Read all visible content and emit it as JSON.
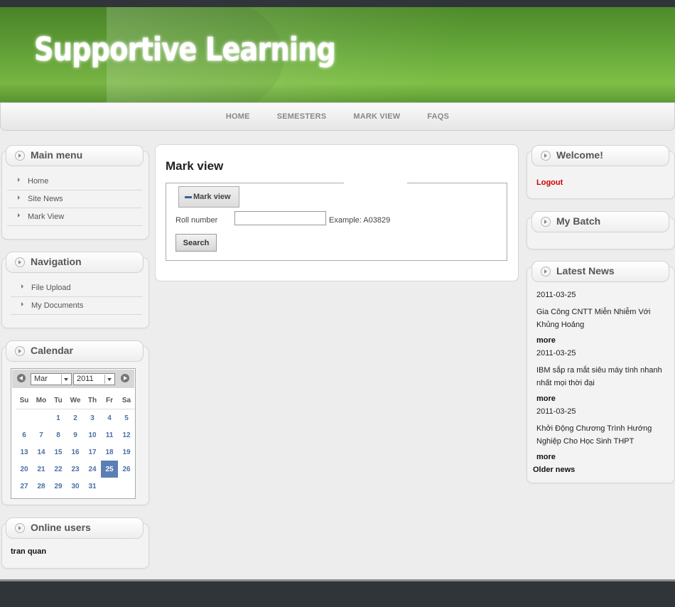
{
  "site": {
    "title": "Supportive Learning"
  },
  "nav": {
    "items": [
      "HOME",
      "SEMESTERS",
      "MARK VIEW",
      "FAQS"
    ]
  },
  "main_menu": {
    "title": "Main menu",
    "items": [
      "Home",
      "Site News",
      "Mark View"
    ]
  },
  "navigation": {
    "title": "Navigation",
    "items": [
      "File Upload",
      "My Documents"
    ]
  },
  "calendar": {
    "title": "Calendar",
    "month": "Mar",
    "year": "2011",
    "weekdays": [
      "Su",
      "Mo",
      "Tu",
      "We",
      "Th",
      "Fr",
      "Sa"
    ],
    "weeks": [
      [
        "",
        "",
        "1",
        "2",
        "3",
        "4",
        "5"
      ],
      [
        "6",
        "7",
        "8",
        "9",
        "10",
        "11",
        "12"
      ],
      [
        "13",
        "14",
        "15",
        "16",
        "17",
        "18",
        "19"
      ],
      [
        "20",
        "21",
        "22",
        "23",
        "24",
        "25",
        "26"
      ],
      [
        "27",
        "28",
        "29",
        "30",
        "31",
        "",
        ""
      ]
    ],
    "selected_day": "25"
  },
  "online_users": {
    "title": "Online users",
    "users": [
      "tran quan"
    ]
  },
  "content": {
    "heading": "Mark view",
    "legend": "Mark view",
    "roll_label": "Roll number",
    "roll_value": "",
    "example": "Example: A03829",
    "search_label": "Search"
  },
  "welcome": {
    "title": "Welcome!",
    "logout_label": "Logout",
    "logout_color": "#cc0000"
  },
  "my_batch": {
    "title": "My Batch"
  },
  "latest_news": {
    "title": "Latest News",
    "items": [
      {
        "date": "2011-03-25",
        "title": "Gia Công CNTT Miễn Nhiễm Với Khủng Hoảng",
        "more": "more"
      },
      {
        "date": "2011-03-25",
        "title": "IBM sắp ra mắt siêu máy tính nhanh nhất mọi thời đại",
        "more": "more"
      },
      {
        "date": "2011-03-25",
        "title": "Khởi Động Chương Trình Hướng Nghiệp Cho Học Sinh THPT",
        "more": "more"
      }
    ],
    "older_label": "Older news"
  }
}
